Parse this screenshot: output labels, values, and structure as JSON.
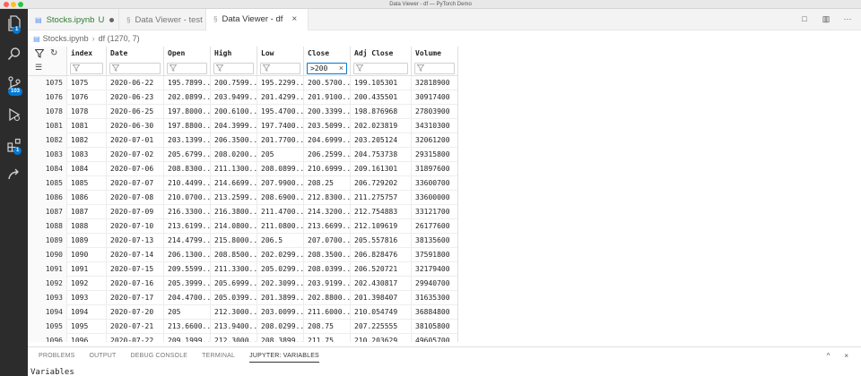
{
  "window": {
    "title": "Data Viewer - df — PyTorch Demo"
  },
  "colors": {
    "accent": "#0078d4",
    "activity_bar": "#2c2c2c",
    "notebook_tab_text": "#2e7d32"
  },
  "activity_bar": {
    "items": [
      {
        "icon": "files-icon",
        "badge": "1"
      },
      {
        "icon": "search-icon",
        "badge": ""
      },
      {
        "icon": "source-control-icon",
        "badge": "103"
      },
      {
        "icon": "run-debug-icon",
        "badge": ""
      },
      {
        "icon": "extensions-icon",
        "badge": "1"
      },
      {
        "icon": "remote-icon",
        "badge": ""
      }
    ]
  },
  "tabs": [
    {
      "label": "Stocks.ipynb",
      "suffix": "U",
      "glyph": "▤",
      "active": false
    },
    {
      "label": "Data Viewer - test",
      "glyph": "§",
      "active": false
    },
    {
      "label": "Data Viewer - df",
      "glyph": "§",
      "close": "×",
      "active": true
    }
  ],
  "tab_actions": [
    {
      "icon": "split-editor-icon",
      "glyph": "□"
    },
    {
      "icon": "open-preview-icon",
      "glyph": "▥"
    },
    {
      "icon": "more-actions-icon",
      "glyph": "···"
    }
  ],
  "breadcrumb": {
    "file": "Stocks.ipynb",
    "symbol": "df (1270, 7)"
  },
  "grid": {
    "columns": [
      {
        "key": "index",
        "label": "index"
      },
      {
        "key": "date",
        "label": "Date"
      },
      {
        "key": "open",
        "label": "Open"
      },
      {
        "key": "high",
        "label": "High"
      },
      {
        "key": "low",
        "label": "Low"
      },
      {
        "key": "close",
        "label": "Close"
      },
      {
        "key": "adj_close",
        "label": "Adj Close"
      },
      {
        "key": "volume",
        "label": "Volume"
      }
    ],
    "filters": {
      "close": ">200"
    },
    "rows": [
      {
        "rowid": "1075",
        "index": "1075",
        "date": "2020-06-22",
        "open": "195.7899...",
        "high": "200.7599...",
        "low": "195.2299...",
        "close": "200.5700...",
        "adj_close": "199.105301",
        "volume": "32818900"
      },
      {
        "rowid": "1076",
        "index": "1076",
        "date": "2020-06-23",
        "open": "202.0899...",
        "high": "203.9499...",
        "low": "201.4299...",
        "close": "201.9100...",
        "adj_close": "200.435501",
        "volume": "30917400"
      },
      {
        "rowid": "1078",
        "index": "1078",
        "date": "2020-06-25",
        "open": "197.8000...",
        "high": "200.6100...",
        "low": "195.4700...",
        "close": "200.3399...",
        "adj_close": "198.876968",
        "volume": "27803900"
      },
      {
        "rowid": "1081",
        "index": "1081",
        "date": "2020-06-30",
        "open": "197.8800...",
        "high": "204.3999...",
        "low": "197.7400...",
        "close": "203.5099...",
        "adj_close": "202.023819",
        "volume": "34310300"
      },
      {
        "rowid": "1082",
        "index": "1082",
        "date": "2020-07-01",
        "open": "203.1399...",
        "high": "206.3500...",
        "low": "201.7700...",
        "close": "204.6999...",
        "adj_close": "203.205124",
        "volume": "32061200"
      },
      {
        "rowid": "1083",
        "index": "1083",
        "date": "2020-07-02",
        "open": "205.6799...",
        "high": "208.0200...",
        "low": "205",
        "close": "206.2599...",
        "adj_close": "204.753738",
        "volume": "29315800"
      },
      {
        "rowid": "1084",
        "index": "1084",
        "date": "2020-07-06",
        "open": "208.8300...",
        "high": "211.1300...",
        "low": "208.0899...",
        "close": "210.6999...",
        "adj_close": "209.161301",
        "volume": "31897600"
      },
      {
        "rowid": "1085",
        "index": "1085",
        "date": "2020-07-07",
        "open": "210.4499...",
        "high": "214.6699...",
        "low": "207.9900...",
        "close": "208.25",
        "adj_close": "206.729202",
        "volume": "33600700"
      },
      {
        "rowid": "1086",
        "index": "1086",
        "date": "2020-07-08",
        "open": "210.0700...",
        "high": "213.2599...",
        "low": "208.6900...",
        "close": "212.8300...",
        "adj_close": "211.275757",
        "volume": "33600000"
      },
      {
        "rowid": "1087",
        "index": "1087",
        "date": "2020-07-09",
        "open": "216.3300...",
        "high": "216.3800...",
        "low": "211.4700...",
        "close": "214.3200...",
        "adj_close": "212.754883",
        "volume": "33121700"
      },
      {
        "rowid": "1088",
        "index": "1088",
        "date": "2020-07-10",
        "open": "213.6199...",
        "high": "214.0800...",
        "low": "211.0800...",
        "close": "213.6699...",
        "adj_close": "212.109619",
        "volume": "26177600"
      },
      {
        "rowid": "1089",
        "index": "1089",
        "date": "2020-07-13",
        "open": "214.4799...",
        "high": "215.8000...",
        "low": "206.5",
        "close": "207.0700...",
        "adj_close": "205.557816",
        "volume": "38135600"
      },
      {
        "rowid": "1090",
        "index": "1090",
        "date": "2020-07-14",
        "open": "206.1300...",
        "high": "208.8500...",
        "low": "202.0299...",
        "close": "208.3500...",
        "adj_close": "206.828476",
        "volume": "37591800"
      },
      {
        "rowid": "1091",
        "index": "1091",
        "date": "2020-07-15",
        "open": "209.5599...",
        "high": "211.3300...",
        "low": "205.0299...",
        "close": "208.0399...",
        "adj_close": "206.520721",
        "volume": "32179400"
      },
      {
        "rowid": "1092",
        "index": "1092",
        "date": "2020-07-16",
        "open": "205.3999...",
        "high": "205.6999...",
        "low": "202.3099...",
        "close": "203.9199...",
        "adj_close": "202.430817",
        "volume": "29940700"
      },
      {
        "rowid": "1093",
        "index": "1093",
        "date": "2020-07-17",
        "open": "204.4700...",
        "high": "205.0399...",
        "low": "201.3899...",
        "close": "202.8800...",
        "adj_close": "201.398407",
        "volume": "31635300"
      },
      {
        "rowid": "1094",
        "index": "1094",
        "date": "2020-07-20",
        "open": "205",
        "high": "212.3000...",
        "low": "203.0099...",
        "close": "211.6000...",
        "adj_close": "210.054749",
        "volume": "36884800"
      },
      {
        "rowid": "1095",
        "index": "1095",
        "date": "2020-07-21",
        "open": "213.6600...",
        "high": "213.9400...",
        "low": "208.0299...",
        "close": "208.75",
        "adj_close": "207.225555",
        "volume": "38105800"
      },
      {
        "rowid": "1096",
        "index": "1096",
        "date": "2020-07-22",
        "open": "209.1999...",
        "high": "212.3000...",
        "low": "208.3899...",
        "close": "211.75",
        "adj_close": "210.203629",
        "volume": "49605700"
      }
    ]
  },
  "panel": {
    "tabs": [
      {
        "label": "PROBLEMS",
        "active": false
      },
      {
        "label": "OUTPUT",
        "active": false
      },
      {
        "label": "DEBUG CONSOLE",
        "active": false
      },
      {
        "label": "TERMINAL",
        "active": false
      },
      {
        "label": "JUPYTER: VARIABLES",
        "active": true
      }
    ],
    "actions": [
      {
        "icon": "maximize-panel-icon",
        "glyph": "^"
      },
      {
        "icon": "close-panel-icon",
        "glyph": "×"
      }
    ],
    "body_text": "Variables"
  }
}
